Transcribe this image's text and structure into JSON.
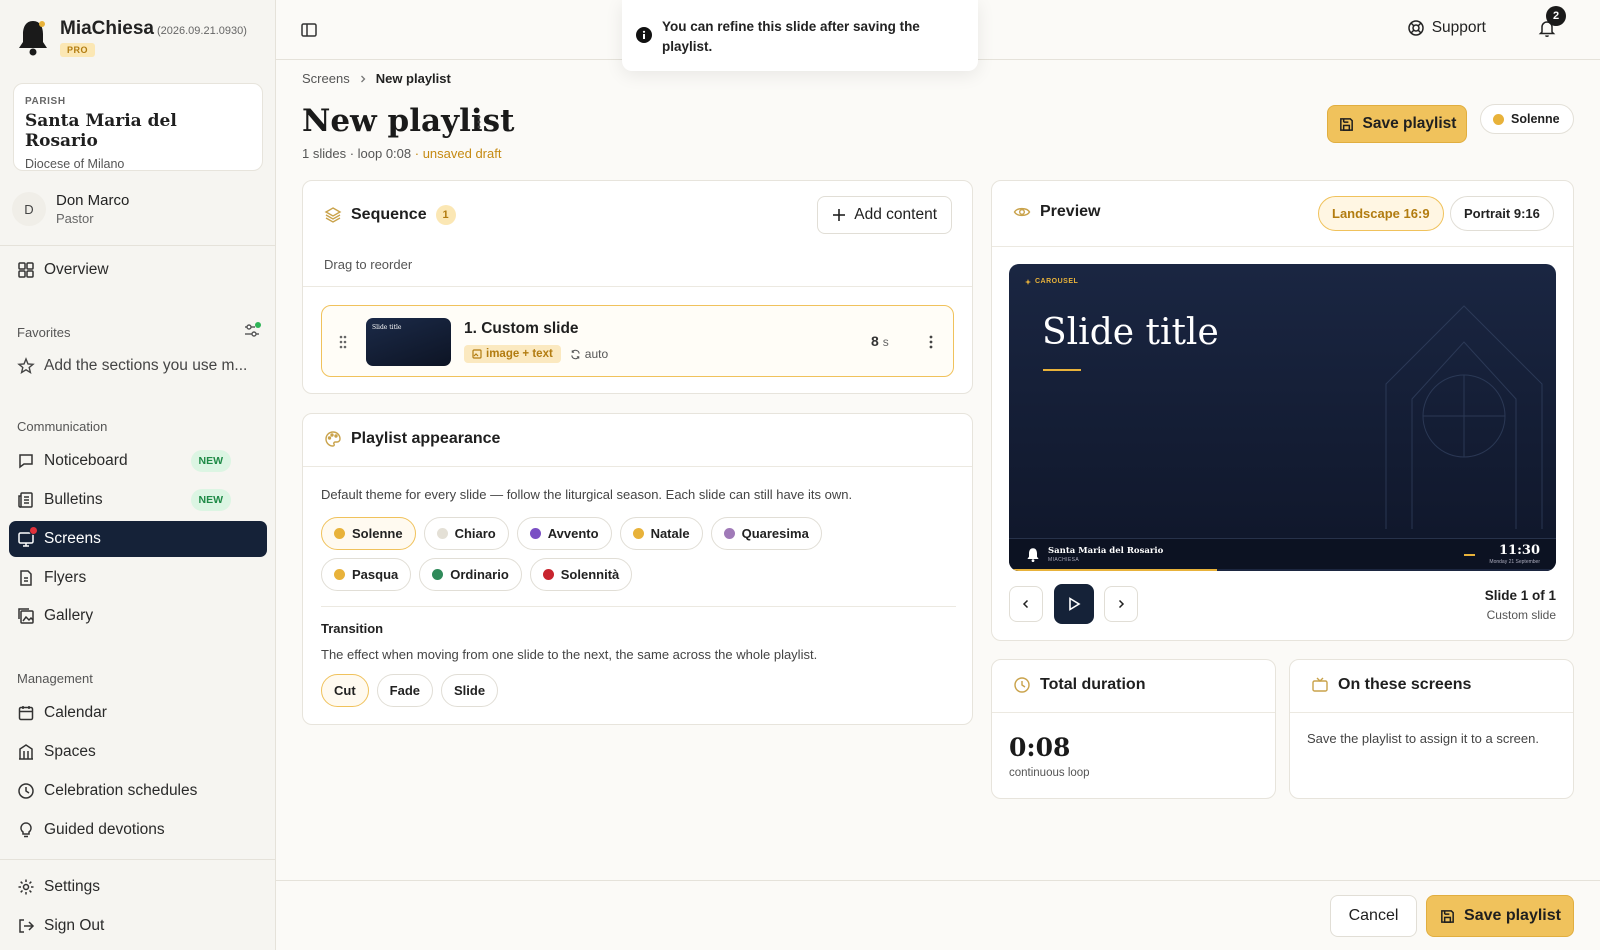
{
  "brand": {
    "name": "MiaChiesa",
    "version": "(2026.09.21.0930)",
    "plan": "PRO"
  },
  "parish": {
    "label": "PARISH",
    "name": "Santa Maria del Rosario",
    "diocese": "Diocese of Milano"
  },
  "user": {
    "initial": "D",
    "name": "Don Marco",
    "role": "Pastor"
  },
  "nav": {
    "overview": "Overview",
    "favorites_title": "Favorites",
    "favorites_hint": "Add the sections you use m...",
    "communication_title": "Communication",
    "noticeboard": "Noticeboard",
    "bulletins": "Bulletins",
    "screens": "Screens",
    "flyers": "Flyers",
    "gallery": "Gallery",
    "new_badge": "NEW",
    "management_title": "Management",
    "calendar": "Calendar",
    "spaces": "Spaces",
    "celebration": "Celebration schedules",
    "devotions": "Guided devotions",
    "settings": "Settings",
    "signout": "Sign Out"
  },
  "topbar": {
    "toast": "You can refine this slide after saving the playlist.",
    "support": "Support",
    "notifications": "2"
  },
  "page": {
    "breadcrumb_root": "Screens",
    "breadcrumb_current": "New playlist",
    "title": "New playlist",
    "meta": "1 slides · loop 0:08",
    "draft": "· unsaved draft",
    "save_label": "Save playlist",
    "theme_pill": "Solenne"
  },
  "sequence": {
    "title": "Sequence",
    "count": "1",
    "add_label": "Add content",
    "hint": "Drag to reorder",
    "slide": {
      "name": "1. Custom slide",
      "type": "image + text",
      "mode": "auto",
      "duration": "8",
      "unit": "s",
      "thumb_text": "Slide title"
    }
  },
  "appearance": {
    "title": "Playlist appearance",
    "desc": "Default theme for every slide — follow the liturgical season. Each slide can still have its own.",
    "themes": [
      {
        "label": "Solenne",
        "color": "#e8b23a"
      },
      {
        "label": "Chiaro",
        "color": "#e4e0d6"
      },
      {
        "label": "Avvento",
        "color": "#7a4fc4"
      },
      {
        "label": "Natale",
        "color": "#e8b23a"
      },
      {
        "label": "Quaresima",
        "color": "#a07ab8"
      },
      {
        "label": "Pasqua",
        "color": "#e8b23a"
      },
      {
        "label": "Ordinario",
        "color": "#2f8a5a"
      },
      {
        "label": "Solennità",
        "color": "#c8242e"
      }
    ],
    "transition_title": "Transition",
    "transition_desc": "The effect when moving from one slide to the next, the same across the whole playlist.",
    "transitions": [
      "Cut",
      "Fade",
      "Slide"
    ]
  },
  "preview": {
    "title": "Preview",
    "landscape": "Landscape 16:9",
    "portrait": "Portrait 9:16",
    "screen": {
      "tag": "CAROUSEL",
      "slide_title": "Slide title",
      "footer_parish": "Santa Maria del Rosario",
      "footer_brand": "MIACHIESA",
      "time": "11:30",
      "date": "Monday 21 September"
    },
    "position": "Slide 1 of 1",
    "position_sub": "Custom slide"
  },
  "duration": {
    "title": "Total duration",
    "value": "0:08",
    "sub": "continuous loop"
  },
  "screens_card": {
    "title": "On these screens",
    "text": "Save the playlist to assign it to a screen."
  },
  "footer": {
    "cancel": "Cancel",
    "save": "Save playlist"
  }
}
